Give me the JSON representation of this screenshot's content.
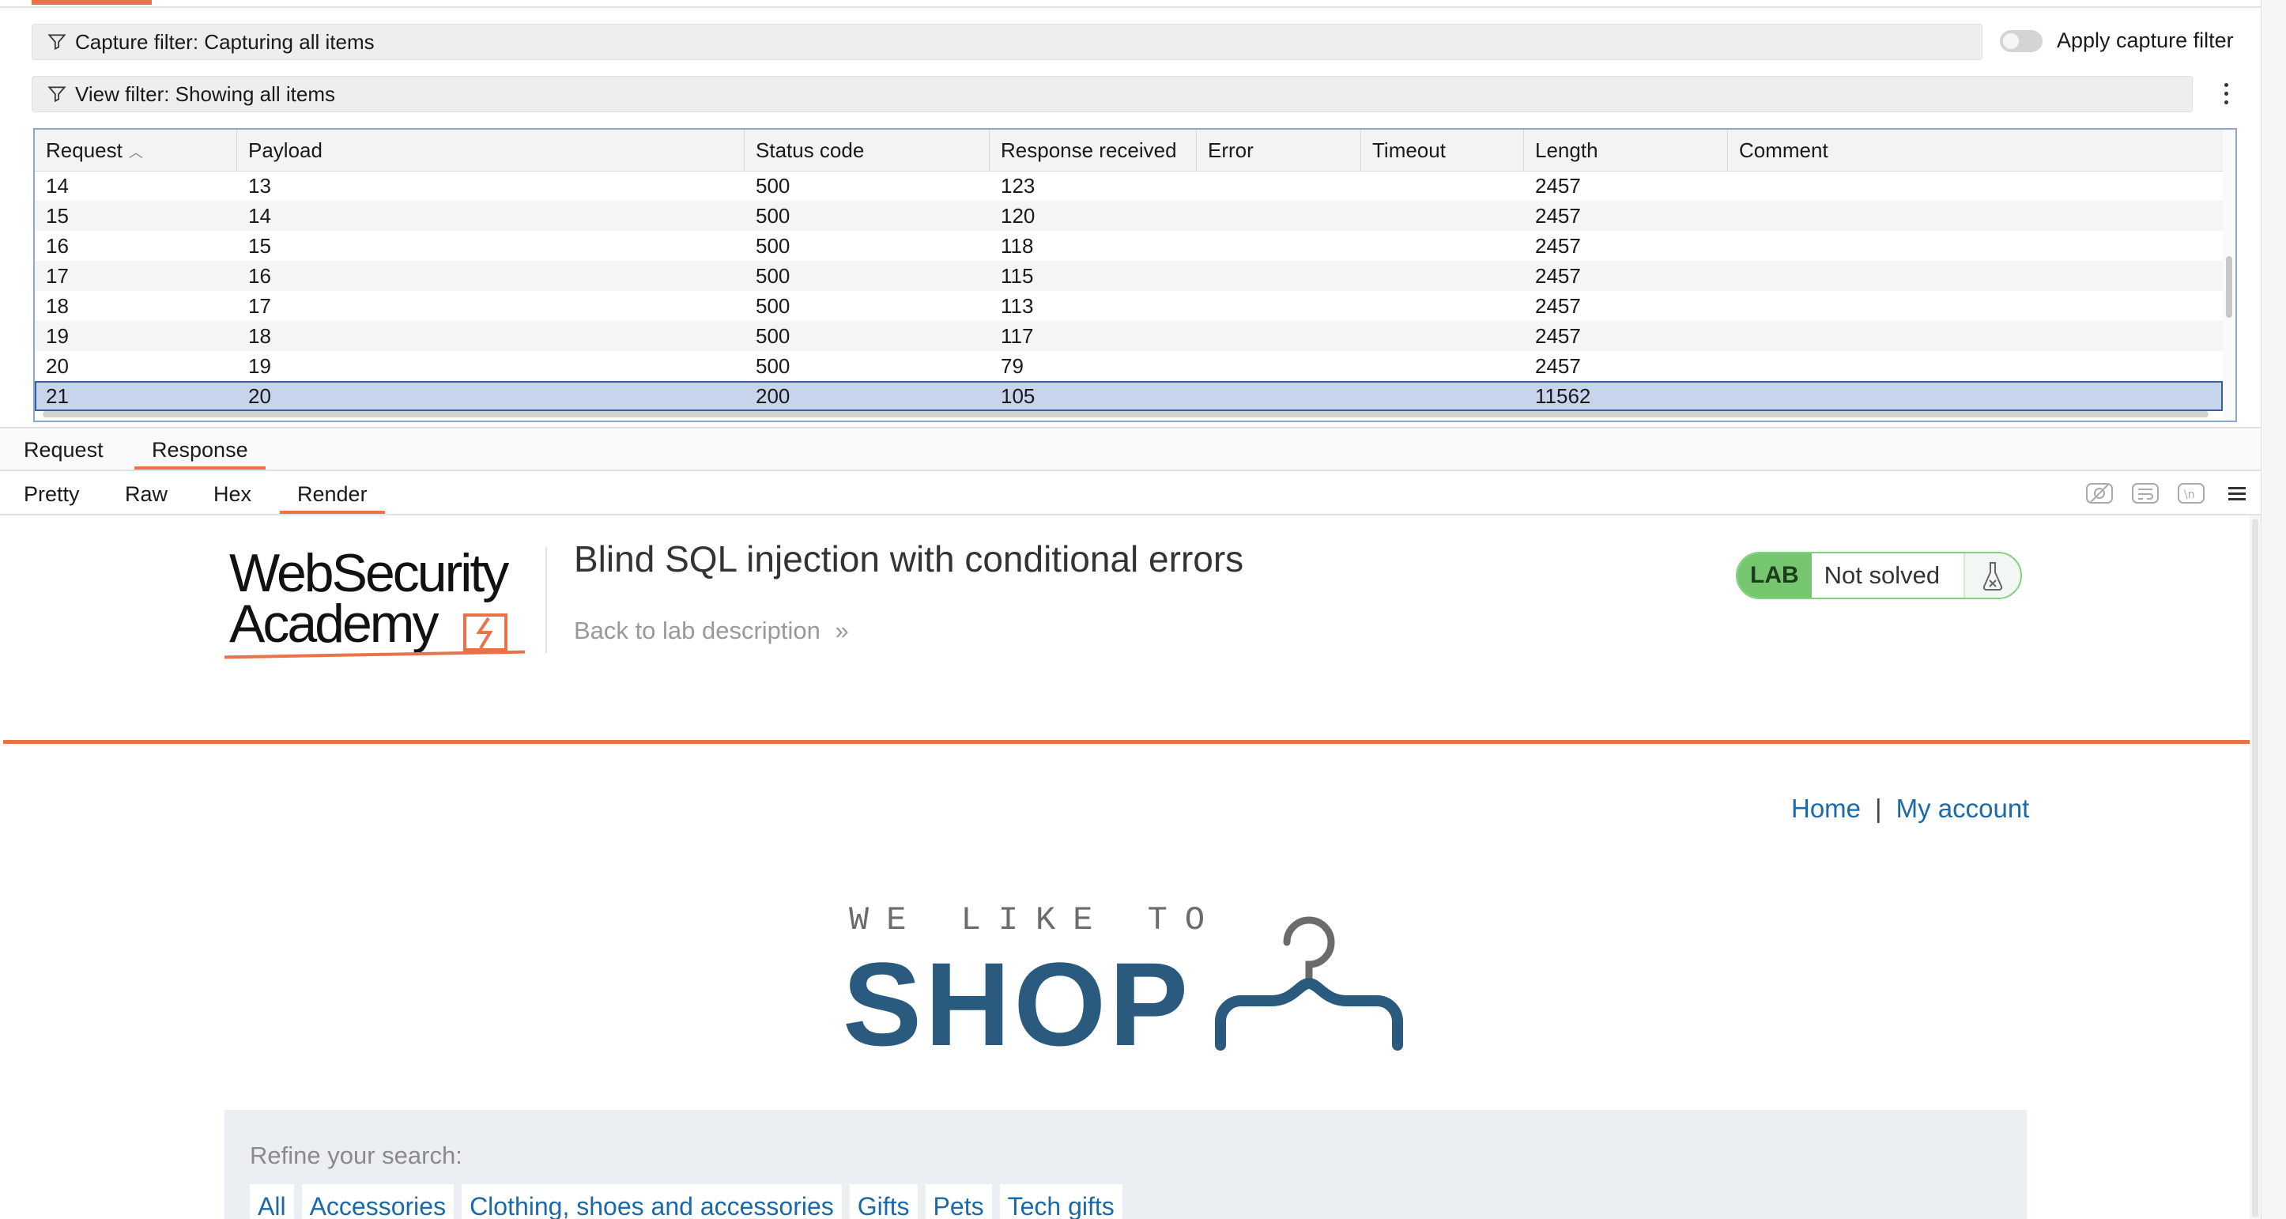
{
  "capture_filter": {
    "label": "Capture filter: Capturing all items",
    "apply_label": "Apply capture filter"
  },
  "view_filter": {
    "label": "View filter: Showing all items"
  },
  "table": {
    "columns": [
      "Request",
      "Payload",
      "Status code",
      "Response received",
      "Error",
      "Timeout",
      "Length",
      "Comment"
    ],
    "rows": [
      [
        "14",
        "13",
        "500",
        "123",
        "",
        "",
        "2457",
        ""
      ],
      [
        "15",
        "14",
        "500",
        "120",
        "",
        "",
        "2457",
        ""
      ],
      [
        "16",
        "15",
        "500",
        "118",
        "",
        "",
        "2457",
        ""
      ],
      [
        "17",
        "16",
        "500",
        "115",
        "",
        "",
        "2457",
        ""
      ],
      [
        "18",
        "17",
        "500",
        "113",
        "",
        "",
        "2457",
        ""
      ],
      [
        "19",
        "18",
        "500",
        "117",
        "",
        "",
        "2457",
        ""
      ],
      [
        "20",
        "19",
        "500",
        "79",
        "",
        "",
        "2457",
        ""
      ],
      [
        "21",
        "20",
        "200",
        "105",
        "",
        "",
        "11562",
        ""
      ]
    ],
    "selected_row": 7
  },
  "detail_tabs": {
    "request": "Request",
    "response": "Response"
  },
  "view_tabs": {
    "pretty": "Pretty",
    "raw": "Raw",
    "hex": "Hex",
    "render": "Render"
  },
  "render": {
    "logo_line1": "WebSecurity",
    "logo_line2": "Academy",
    "lab_title": "Blind SQL injection with conditional errors",
    "back_link": "Back to lab description",
    "lab_tag": "LAB",
    "lab_status": "Not solved",
    "nav_home": "Home",
    "nav_sep": "|",
    "nav_account": "My account",
    "shop_tagline": "WE LIKE TO",
    "shop_word": "SHOP",
    "refine_label": "Refine your search:",
    "categories": [
      "All",
      "Accessories",
      "Clothing, shoes and accessories",
      "Gifts",
      "Pets",
      "Tech gifts"
    ]
  },
  "colors": {
    "accent": "#e8734a",
    "link": "#1a69a8",
    "selected_row": "#c6d5ec",
    "lab_green": "#76c66f",
    "shop_blue": "#2a5b7f"
  }
}
